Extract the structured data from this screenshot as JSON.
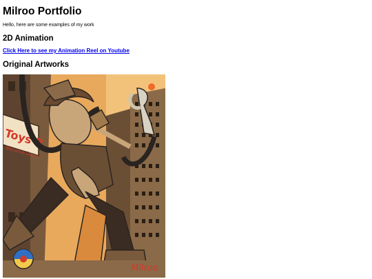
{
  "page": {
    "title": "Milroo Portfolio",
    "intro": "Hello, here are some examples of my work",
    "sections": {
      "animation": {
        "heading": "2D Animation",
        "link_text": "Click Here to see my Animation Reel on Youtube"
      },
      "artworks": {
        "heading": "Original Artworks"
      }
    },
    "artwork": {
      "sign_text": "Toys R",
      "sign_subtext": "Become Destr",
      "signature": "Milroo"
    }
  },
  "colors": {
    "link": "#0000ee",
    "art_sky": "#e8a95c",
    "art_sun": "#f06a2a",
    "art_building": "#8a6a48",
    "art_sign_red": "#d23a2a"
  }
}
